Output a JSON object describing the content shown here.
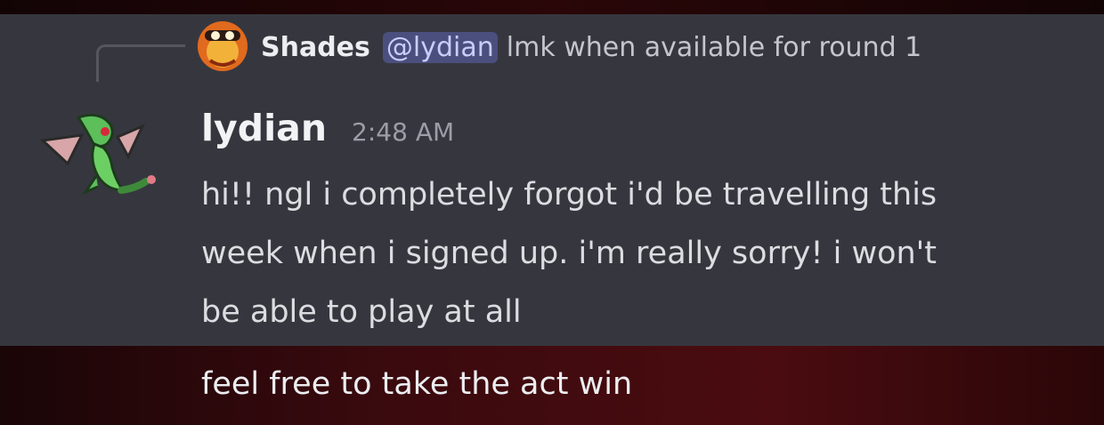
{
  "reply": {
    "author": "Shades",
    "mention": "@lydian",
    "text": "lmk when available for round 1"
  },
  "message": {
    "author": "lydian",
    "timestamp": "2:48 AM",
    "lines": [
      "hi!! ngl i completely forgot i'd be travelling this",
      "week when i signed up. i'm really sorry! i won't",
      "be able to play at all"
    ]
  },
  "followup": {
    "text": "feel free to take the act win"
  },
  "colors": {
    "panel": "#36373e",
    "mention_bg": "#4a4f7e",
    "mention_text": "#c9cdfb",
    "backdrop": "#3a0a0e"
  }
}
